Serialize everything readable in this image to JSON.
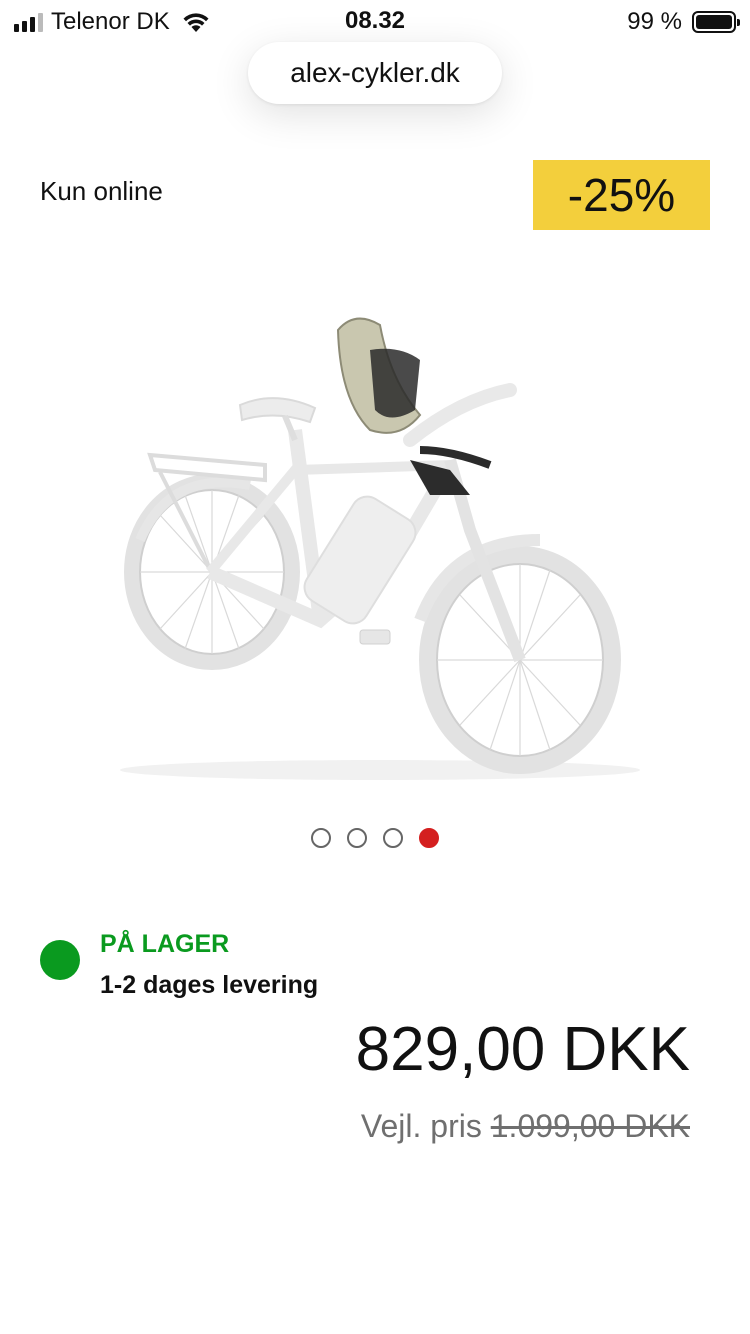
{
  "status_bar": {
    "carrier": "Telenor DK",
    "time": "08.32",
    "battery": "99 %",
    "battery_level": 0.99
  },
  "browser": {
    "url": "alex-cykler.dk"
  },
  "product": {
    "online_badge": "Kun online",
    "discount_badge": "-25%",
    "discount_color": "#f3cf3c",
    "image_icon": "bicycle-with-child-seat",
    "carousel": {
      "count": 4,
      "active_index": 3,
      "active_color": "#d41f1f"
    },
    "stock": {
      "status": "PÅ LAGER",
      "delivery": "1-2 dages levering",
      "color": "#0a9a1f"
    },
    "price": "829,00 DKK",
    "rrp_label": "Vejl. pris",
    "rrp_value": "1.099,00 DKK"
  }
}
